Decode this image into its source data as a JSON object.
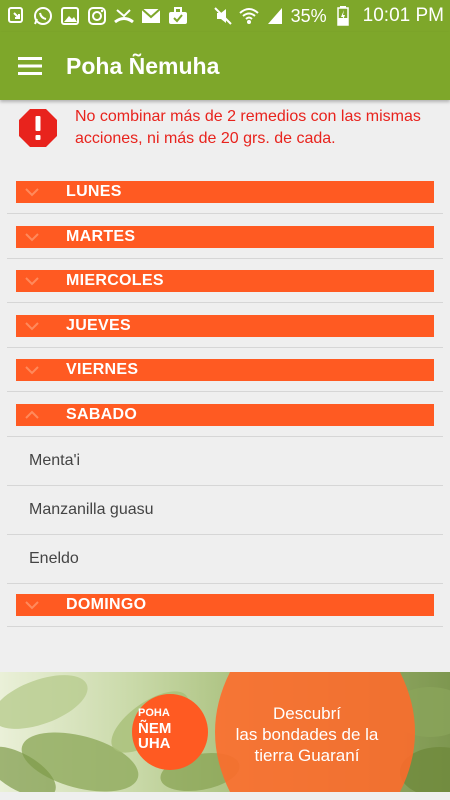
{
  "status_bar": {
    "battery_percent": "35%",
    "time": "10:01 PM"
  },
  "app_bar": {
    "title": "Poha Ñemuha"
  },
  "warning": {
    "text": "No combinar más de 2 remedios con las mismas acciones, ni más de 20 grs. de cada."
  },
  "days": [
    {
      "label": "LUNES",
      "expanded": false
    },
    {
      "label": "MARTES",
      "expanded": false
    },
    {
      "label": "MIERCOLES",
      "expanded": false
    },
    {
      "label": "JUEVES",
      "expanded": false
    },
    {
      "label": "VIERNES",
      "expanded": false
    },
    {
      "label": "SABADO",
      "expanded": true,
      "items": [
        "Menta'i",
        "Manzanilla guasu",
        "Eneldo"
      ]
    },
    {
      "label": "DOMINGO",
      "expanded": false
    }
  ],
  "banner": {
    "logo_lines": [
      "POHA",
      "ÑEM",
      "UHA"
    ],
    "tagline_lines": [
      "Descubrí",
      "las bondades de la",
      "tierra Guaraní"
    ]
  },
  "colors": {
    "primary": "#7ea72a",
    "accent": "#ff5a22",
    "warning": "#e8231d",
    "background": "#efefef"
  }
}
